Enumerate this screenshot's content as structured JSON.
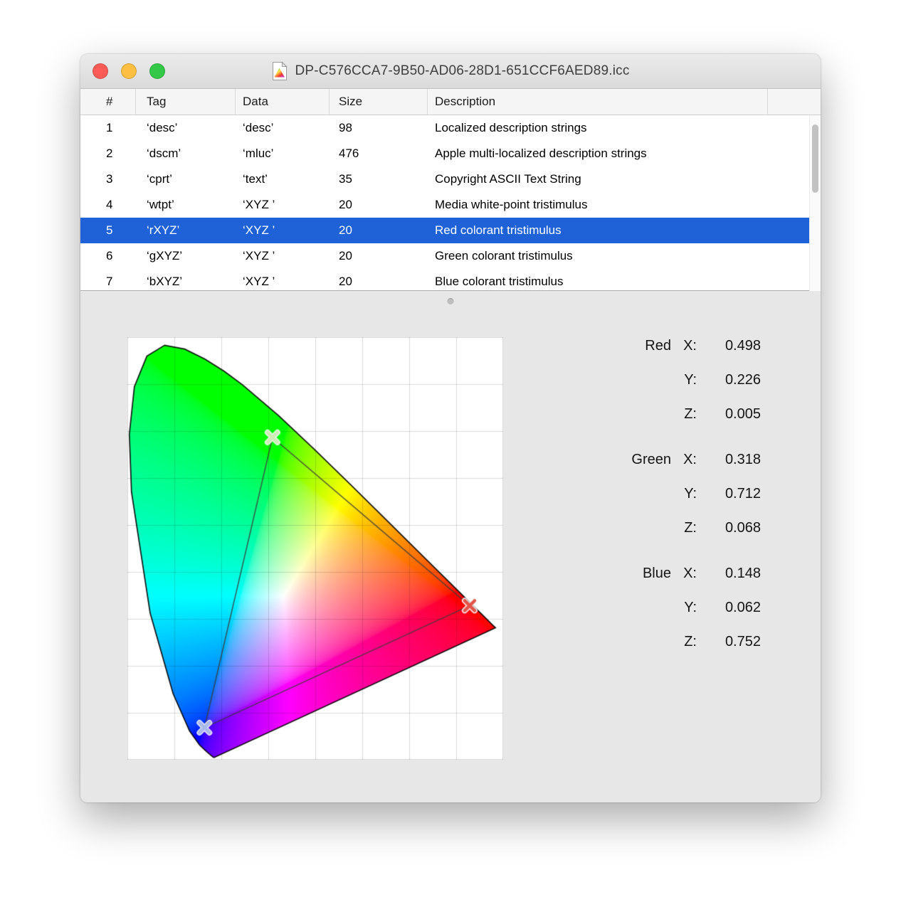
{
  "window": {
    "title": "DP-C576CCA7-9B50-AD06-28D1-651CCF6AED89.icc"
  },
  "table": {
    "columns": [
      "#",
      "Tag",
      "Data",
      "Size",
      "Description"
    ],
    "selected_row_number": 5,
    "rows": [
      [
        "1",
        "‘desc’",
        "‘desc’",
        "98",
        "Localized description strings"
      ],
      [
        "2",
        "‘dscm’",
        "‘mluc’",
        "476",
        "Apple multi-localized description strings"
      ],
      [
        "3",
        "‘cprt’",
        "‘text’",
        "35",
        "Copyright ASCII Text String"
      ],
      [
        "4",
        "‘wtpt’",
        "‘XYZ ’",
        "20",
        "Media white-point tristimulus"
      ],
      [
        "5",
        "‘rXYZ’",
        "‘XYZ ’",
        "20",
        "Red colorant tristimulus"
      ],
      [
        "6",
        "‘gXYZ’",
        "‘XYZ ’",
        "20",
        "Green colorant tristimulus"
      ],
      [
        "7",
        "‘bXYZ’",
        "‘XYZ ’",
        "20",
        "Blue colorant tristimulus"
      ]
    ]
  },
  "panel": {
    "groups": [
      {
        "name": "Red",
        "rows": [
          {
            "axis": "X:",
            "value": "0.498"
          },
          {
            "axis": "Y:",
            "value": "0.226"
          },
          {
            "axis": "Z:",
            "value": "0.005"
          }
        ]
      },
      {
        "name": "Green",
        "rows": [
          {
            "axis": "X:",
            "value": "0.318"
          },
          {
            "axis": "Y:",
            "value": "0.712"
          },
          {
            "axis": "Z:",
            "value": "0.068"
          }
        ]
      },
      {
        "name": "Blue",
        "rows": [
          {
            "axis": "X:",
            "value": "0.148"
          },
          {
            "axis": "Y:",
            "value": "0.062"
          },
          {
            "axis": "Z:",
            "value": "0.752"
          }
        ]
      }
    ]
  },
  "colors": {
    "selection_blue": "#1f62d8",
    "traffic_red": "#fc5b57",
    "traffic_yellow": "#fdbe41",
    "traffic_green": "#34c848"
  },
  "chart_data": {
    "type": "scatter",
    "title": "CIE 1931 xy chromaticity diagram with profile colorant triangle",
    "x_range": [
      0,
      0.75
    ],
    "y_range": [
      0,
      0.85
    ],
    "grid": true,
    "grid_cells_x": 8,
    "grid_cells_y": 9,
    "primaries": [
      {
        "name": "Red",
        "XYZ": [
          0.498,
          0.226,
          0.005
        ],
        "marker_color": "#e2544a"
      },
      {
        "name": "Green",
        "XYZ": [
          0.318,
          0.712,
          0.068
        ],
        "marker_color": "#cfeab6"
      },
      {
        "name": "Blue",
        "XYZ": [
          0.148,
          0.062,
          0.752
        ],
        "marker_color": "#a9b8ee"
      }
    ]
  }
}
